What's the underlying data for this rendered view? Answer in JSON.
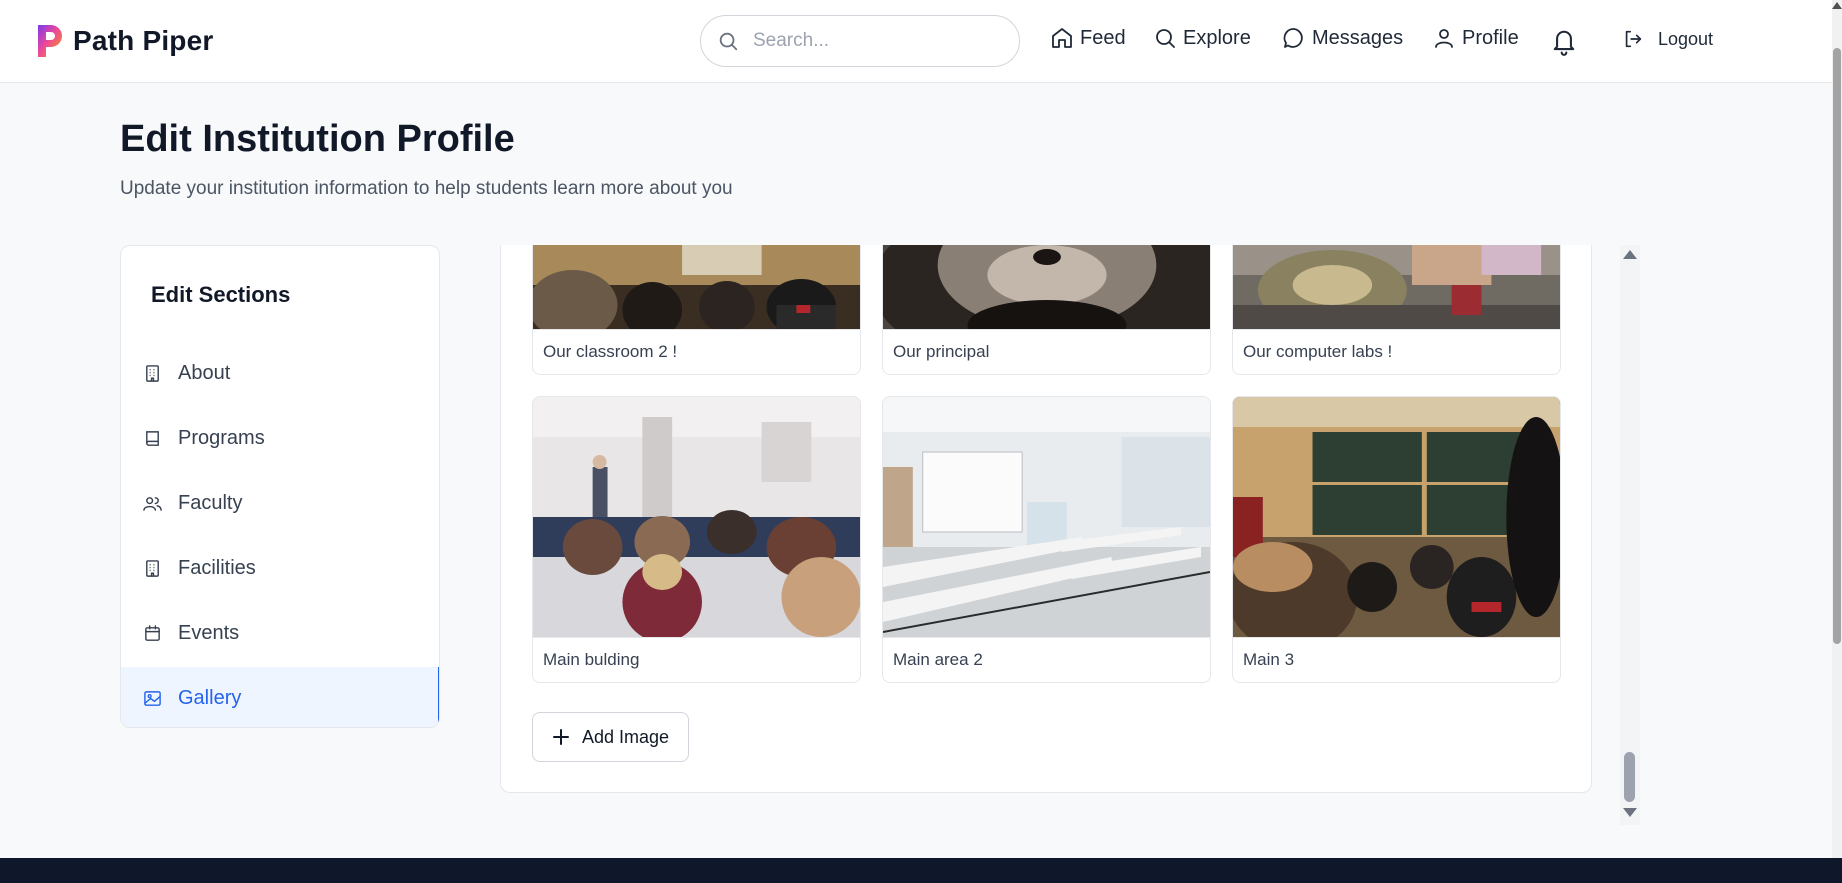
{
  "header": {
    "brand": "Path Piper",
    "search_placeholder": "Search...",
    "nav": [
      {
        "label": "Feed",
        "icon": "home-icon"
      },
      {
        "label": "Explore",
        "icon": "search-icon"
      },
      {
        "label": "Messages",
        "icon": "message-icon"
      },
      {
        "label": "Profile",
        "icon": "user-icon"
      }
    ],
    "notifications_icon": "bell-icon",
    "logout_label": "Logout"
  },
  "page": {
    "title": "Edit Institution Profile",
    "subtitle": "Update your institution information to help students learn more about you"
  },
  "sidebar": {
    "title": "Edit Sections",
    "items": [
      {
        "label": "About",
        "icon": "building-icon",
        "active": false
      },
      {
        "label": "Programs",
        "icon": "book-icon",
        "active": false
      },
      {
        "label": "Faculty",
        "icon": "users-icon",
        "active": false
      },
      {
        "label": "Facilities",
        "icon": "building-icon",
        "active": false
      },
      {
        "label": "Events",
        "icon": "calendar-icon",
        "active": false
      },
      {
        "label": "Gallery",
        "icon": "image-icon",
        "active": true
      }
    ]
  },
  "gallery": {
    "images": [
      {
        "caption": "Our classroom 2 !"
      },
      {
        "caption": "Our principal"
      },
      {
        "caption": "Our computer labs !"
      },
      {
        "caption": "Main bulding"
      },
      {
        "caption": "Main area 2"
      },
      {
        "caption": "Main 3"
      }
    ],
    "add_label": "Add Image"
  },
  "colors": {
    "accent": "#2563eb",
    "active_bg": "#eef5ff",
    "footer": "#0f172a",
    "page_bg": "#f8f9fb"
  }
}
